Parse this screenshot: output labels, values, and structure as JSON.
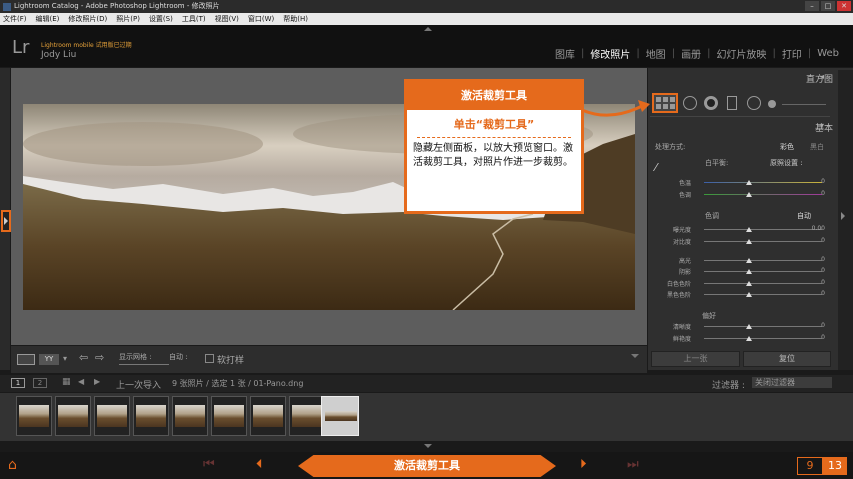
{
  "window": {
    "title": "Lightroom Catalog - Adobe Photoshop Lightroom - 修改照片"
  },
  "menu": [
    "文件(F)",
    "编辑(E)",
    "修改照片(D)",
    "照片(P)",
    "设置(S)",
    "工具(T)",
    "视图(V)",
    "窗口(W)",
    "帮助(H)"
  ],
  "identity": {
    "logo": "Lr",
    "mobile_note": "Lightroom mobile 试用版已过期",
    "user": "Jody Liu"
  },
  "modules": [
    {
      "label": "图库",
      "active": false
    },
    {
      "label": "修改照片",
      "active": true
    },
    {
      "label": "地图",
      "active": false
    },
    {
      "label": "画册",
      "active": false
    },
    {
      "label": "幻灯片放映",
      "active": false
    },
    {
      "label": "打印",
      "active": false
    },
    {
      "label": "Web",
      "active": false
    }
  ],
  "right_panel": {
    "histogram_label": "直方图",
    "basic_label": "基本",
    "treatment_label": "处理方式:",
    "color_label": "彩色",
    "bw_label": "黑白",
    "wb_label": "白平衡:",
    "wb_value": "原照设置 :",
    "tone_label": "色调",
    "auto_label": "自动",
    "presence_label": "偏好",
    "temp": {
      "label": "色温",
      "value": "0"
    },
    "tint": {
      "label": "色调",
      "value": "0"
    },
    "exposure": {
      "label": "曝光度",
      "value": "0.00"
    },
    "contrast": {
      "label": "对比度",
      "value": "0"
    },
    "highlights": {
      "label": "高光",
      "value": "0"
    },
    "shadows": {
      "label": "阴影",
      "value": "0"
    },
    "whites": {
      "label": "白色色阶",
      "value": "0"
    },
    "blacks": {
      "label": "黑色色阶",
      "value": "0"
    },
    "clarity": {
      "label": "清晰度",
      "value": "0"
    },
    "vibrance": {
      "label": "鲜艳度",
      "value": "0"
    },
    "previous_btn": "上一张",
    "reset_btn": "复位"
  },
  "toolbar": {
    "grid_label": "显示网格 :",
    "grid_value": "自动 :",
    "soft_proof_label": "软打样"
  },
  "callout": {
    "title": "激活裁剪工具",
    "subtitle": "单击“裁剪工具”",
    "body": "隐藏左侧面板，以放大预览窗口。激活裁剪工具，对照片作进一步裁剪。"
  },
  "filmstrip": {
    "page1": "1",
    "page2": "2",
    "source": "上一次导入",
    "info": "9 张照片 / 选定 1 张 / 01-Pano.dng",
    "filter_label": "过滤器 :",
    "filter_value": "关闭过滤器",
    "thumb_count": 9
  },
  "bottom": {
    "banner": "激活裁剪工具",
    "step_current": "9",
    "step_total": "13"
  },
  "colors": {
    "accent": "#e56a1c"
  }
}
